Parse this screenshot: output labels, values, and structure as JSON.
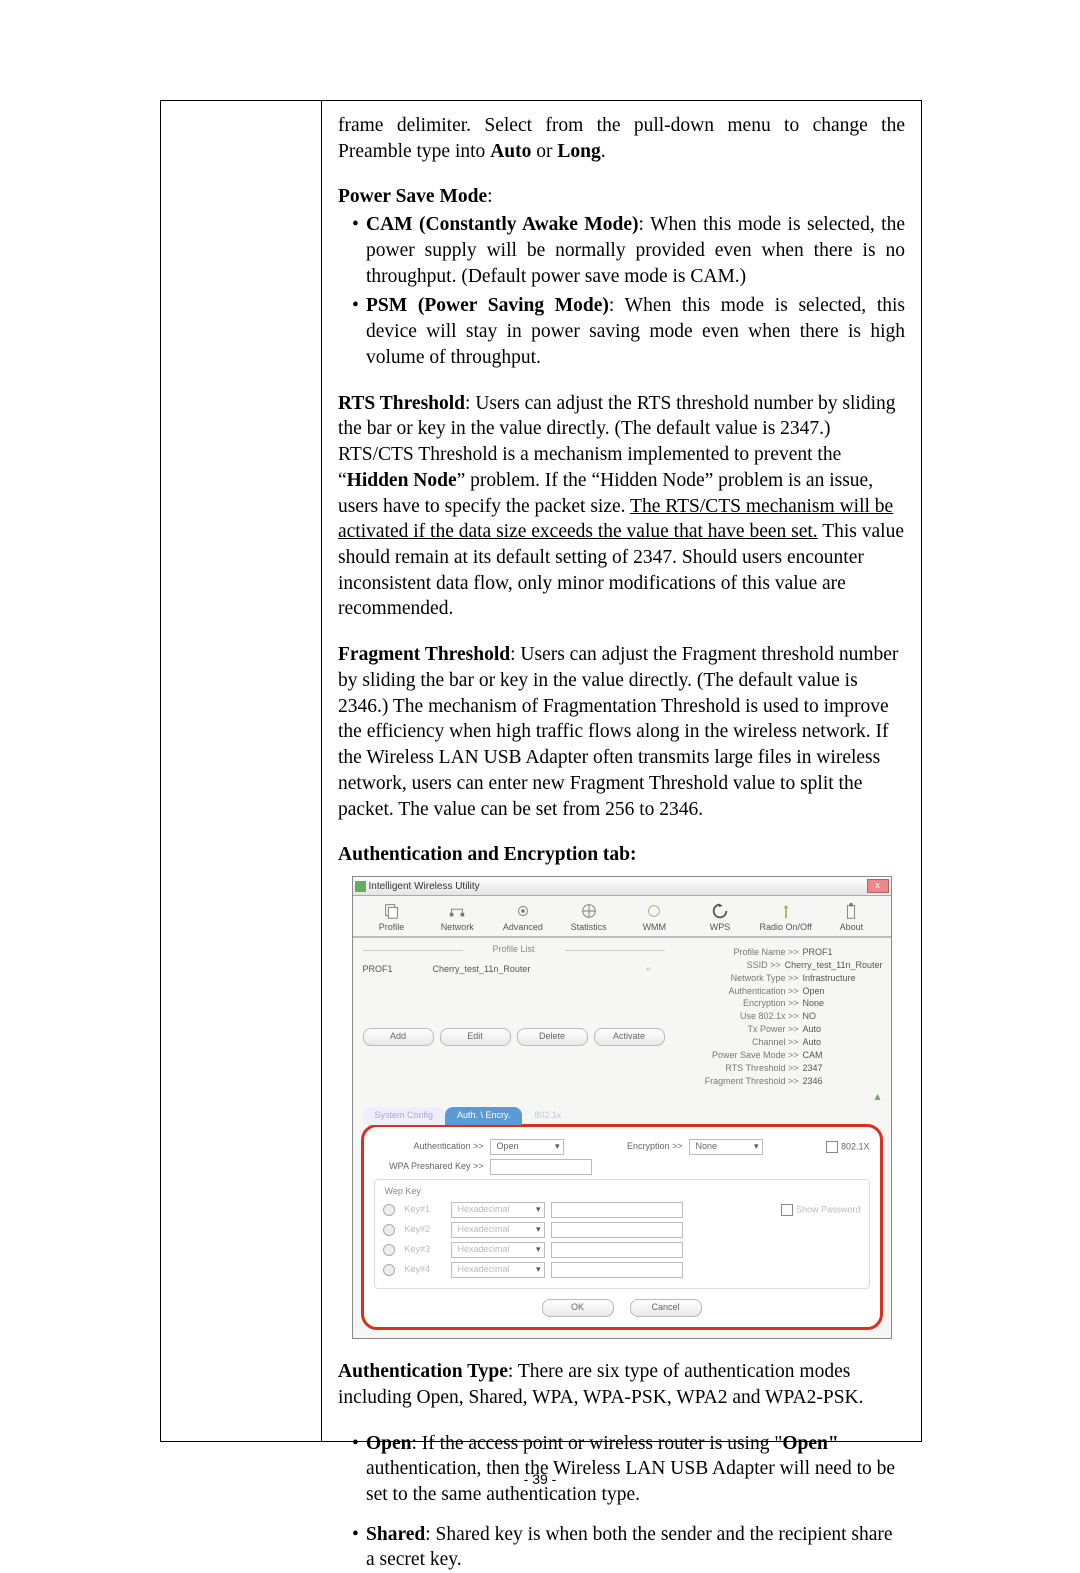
{
  "para_preamble": "frame delimiter. Select from the pull-down menu to change the Preamble type into ",
  "bold_auto": "Auto",
  "or_word": " or ",
  "bold_long": "Long",
  "period": ".",
  "psm_heading": "Power Save Mode",
  "psm_items": {
    "cam_b": "CAM (Constantly Awake Mode)",
    "cam_txt": ": When this mode is selected, the power supply will be normally provided even when there is no throughput. (Default power save mode is CAM.)",
    "psm_b": "PSM (Power Saving Mode)",
    "psm_txt": ": When this mode is selected, this device will stay in power saving mode even when there is high volume of throughput."
  },
  "rts": {
    "b": "RTS Threshold",
    "t1": ": Users can adjust the RTS threshold number by sliding the bar or key in the value directly. (The default value is 2347.) RTS/CTS Threshold is a mechanism implemented to prevent the “",
    "hn": "Hidden Node",
    "t2": "” problem. If the “Hidden Node” problem is an issue, users have to specify the packet size. ",
    "u": "The RTS/CTS mechanism will be activated if the data size exceeds the value that have been set.",
    "t3": " This value should remain at its default setting of 2347. Should users encounter inconsistent data flow, only minor modifications of this value are recommended."
  },
  "frag": {
    "b": "Fragment Threshold",
    "t": ": Users can adjust the Fragment threshold number by sliding the bar or key in the value directly. (The default value is 2346.) The mechanism of Fragmentation Threshold is used to improve the efficiency when high traffic flows along in the wireless network. If the Wireless LAN USB Adapter often transmits large files in wireless network, users can enter new Fragment Threshold value to split the packet. The value can be set from 256 to 2346."
  },
  "auth_tab_heading": "Authentication and Encryption tab:",
  "ss": {
    "title": "Intelligent Wireless Utility",
    "tabs": [
      "Profile",
      "Network",
      "Advanced",
      "Statistics",
      "WMM",
      "WPS",
      "Radio On/Off",
      "About"
    ],
    "profile_list_label": "Profile List",
    "prof_name": "PROF1",
    "prof_ssid": "Cherry_test_11n_Router",
    "details": [
      [
        "Profile Name >>",
        "PROF1"
      ],
      [
        "SSID >>",
        "Cherry_test_11n_Router"
      ],
      [
        "Network Type >>",
        "Infrastructure"
      ],
      [
        "Authentication >>",
        "Open"
      ],
      [
        "Encryption >>",
        "None"
      ],
      [
        "Use 802.1x >>",
        "NO"
      ],
      [
        "Tx Power >>",
        "Auto"
      ],
      [
        "Channel >>",
        "Auto"
      ],
      [
        "Power Save Mode >>",
        "CAM"
      ],
      [
        "RTS Threshold >>",
        "2347"
      ],
      [
        "Fragment Threshold >>",
        "2346"
      ]
    ],
    "btns": [
      "Add",
      "Edit",
      "Delete",
      "Activate"
    ],
    "tab2": {
      "a": "System Config",
      "b": "Auth. \\ Encry.",
      "c": "802.1x"
    },
    "labels": {
      "auth": "Authentication >>",
      "enc": "Encryption >>",
      "c8021x": "802.1X",
      "wpapsk": "WPA Preshared Key >>",
      "wep": "Wep Key",
      "keys": [
        "Key#1",
        "Key#2",
        "Key#3",
        "Key#4"
      ],
      "hex": "Hexadecimal",
      "showpw": "Show Password",
      "ok": "OK",
      "cancel": "Cancel",
      "open": "Open",
      "none": "None"
    }
  },
  "auth_type": {
    "b": "Authentication Type",
    "t": ": There are six type of authentication modes including Open, Shared, WPA, WPA-PSK, WPA2 and WPA2-PSK."
  },
  "open_item": {
    "b1": "Open",
    "t1": ": If the access point or wireless router is using \"",
    "b2": "Open\"",
    "t2": " authentication, then the Wireless LAN USB Adapter will need to be set to the same authentication type."
  },
  "shared_item": {
    "b": "Shared",
    "t": ": Shared key is when both the sender and the recipient share a secret key."
  },
  "page_number": "- 39 -"
}
